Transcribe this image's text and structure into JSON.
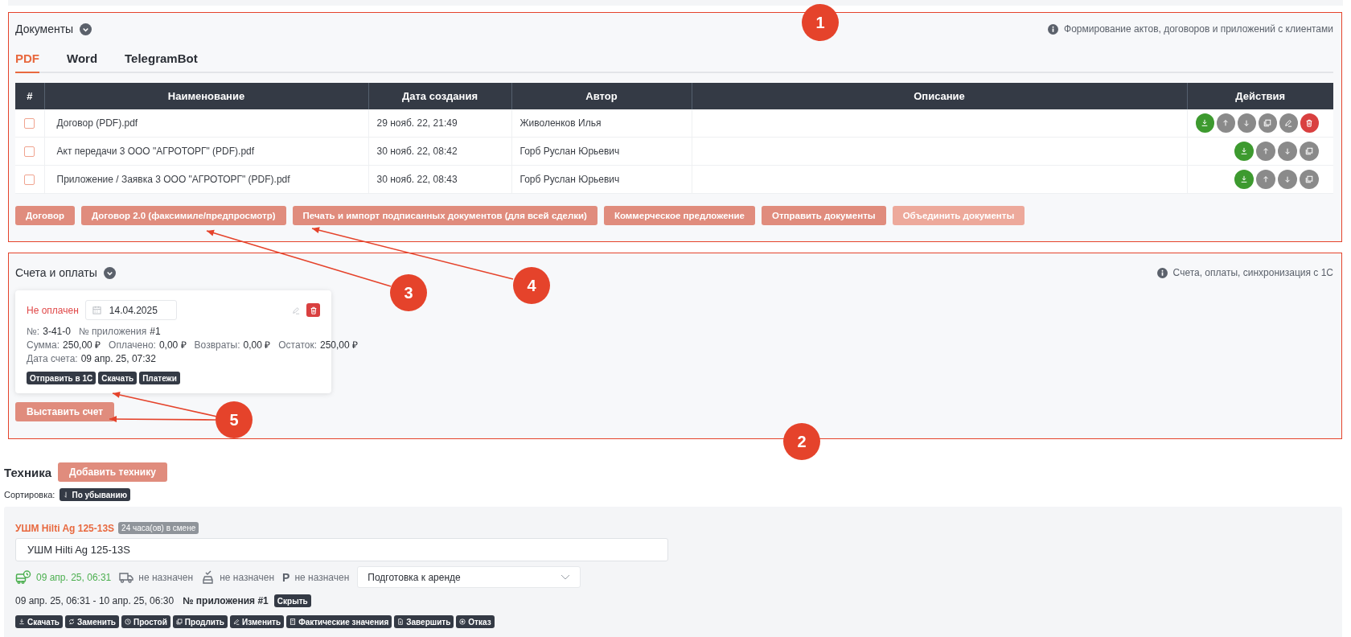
{
  "documents": {
    "title": "Документы",
    "info": "Формирование актов, договоров и приложений с клиентами",
    "tabs": [
      {
        "label": "PDF",
        "selected": true
      },
      {
        "label": "Word",
        "selected": false
      },
      {
        "label": "TelegramBot",
        "selected": false
      }
    ],
    "table": {
      "columns": [
        "#",
        "Наименование",
        "Дата создания",
        "Автор",
        "Описание",
        "Действия"
      ],
      "rows": [
        {
          "checked": false,
          "name": "Договор (PDF).pdf",
          "created": "29 нояб. 22, 21:49",
          "author": "Живоленков Илья",
          "actions": [
            {
              "kind": "download"
            },
            {
              "kind": "up"
            },
            {
              "kind": "down"
            },
            {
              "kind": "copy"
            },
            {
              "kind": "edit"
            },
            {
              "kind": "delete"
            }
          ]
        },
        {
          "checked": false,
          "name": "Акт передачи 3 ООО \"АГРОТОРГ\" (PDF).pdf",
          "created": "30 нояб. 22, 08:42",
          "author": "Горб Руслан Юрьевич",
          "actions": [
            {
              "kind": "download"
            },
            {
              "kind": "up"
            },
            {
              "kind": "down"
            },
            {
              "kind": "copy"
            }
          ]
        },
        {
          "checked": false,
          "name": "Приложение / Заявка 3 ООО \"АГРОТОРГ\" (PDF).pdf",
          "created": "30 нояб. 22, 08:43",
          "author": "Горб Руслан Юрьевич",
          "actions": [
            {
              "kind": "download"
            },
            {
              "kind": "up"
            },
            {
              "kind": "down"
            },
            {
              "kind": "copy"
            }
          ]
        }
      ]
    },
    "buttons": [
      {
        "label": "Договор",
        "disabled": false
      },
      {
        "label": "Договор 2.0 (факсимиле/предпросмотр)",
        "disabled": false
      },
      {
        "label": "Печать и импорт подписанных документов (для всей сделки)",
        "disabled": false
      },
      {
        "label": "Коммерческое предложение",
        "disabled": false
      },
      {
        "label": "Отправить документы",
        "disabled": false
      },
      {
        "label": "Объединить документы",
        "disabled": true
      }
    ]
  },
  "invoices": {
    "title": "Счета и оплаты",
    "info": "Счета, оплаты, синхронизация с 1С",
    "cards": [
      {
        "status": "Не оплачен",
        "paid": false,
        "date": "14.04.2025",
        "fields": [
          [
            {
              "label": "№:",
              "value": "3-41-0"
            },
            {
              "label": "№ приложения",
              "value": "#1"
            }
          ],
          [
            {
              "label": "Сумма:",
              "value": "250,00 ₽"
            },
            {
              "label": "Оплачено:",
              "value": "0,00 ₽"
            },
            {
              "label": "Возвраты:",
              "value": "0,00 ₽"
            },
            {
              "label": "Остаток:",
              "value": "250,00 ₽"
            }
          ],
          [
            {
              "label": "Дата счета:",
              "value": "09 апр. 25, 07:32"
            }
          ]
        ],
        "buttons": [
          "Отправить в 1С",
          "Скачать",
          "Платежи"
        ]
      }
    ],
    "issue_button": "Выставить счет"
  },
  "equipment": {
    "title": "Техника",
    "add_button": "Добавить технику",
    "sort_label": "Сортировка:",
    "sort_button": "По убыванию",
    "items": [
      {
        "name": "УШМ Hilti Ag 125-13S",
        "badge": "24 часа(ов) в смене",
        "value": "УШМ Hilti Ag 125-13S",
        "start": "09 апр. 25, 06:31",
        "assignments": [
          {
            "kind": "truck",
            "text": "не назначен"
          },
          {
            "kind": "driver",
            "text": "не назначен"
          },
          {
            "kind": "parking",
            "icon": "P",
            "text": "не назначен"
          }
        ],
        "stage": "Подготовка к аренде",
        "period": "09 апр. 25, 06:31 - 10 апр. 25, 06:30",
        "appendix": "№ приложения #1",
        "hide_button": "Скрыть",
        "actions": [
          {
            "kind": "download",
            "label": "Скачать"
          },
          {
            "kind": "replace",
            "label": "Заменить"
          },
          {
            "kind": "clock",
            "label": "Простой"
          },
          {
            "kind": "copy",
            "label": "Продлить"
          },
          {
            "kind": "edit",
            "label": "Изменить"
          },
          {
            "kind": "calc",
            "label": "Фактические значения"
          },
          {
            "kind": "file",
            "label": "Завершить"
          },
          {
            "kind": "cancel",
            "label": "Отказ"
          }
        ]
      }
    ]
  },
  "annotations": [
    {
      "label": "1"
    },
    {
      "label": "2"
    },
    {
      "label": "3"
    },
    {
      "label": "4"
    },
    {
      "label": "5"
    }
  ]
}
